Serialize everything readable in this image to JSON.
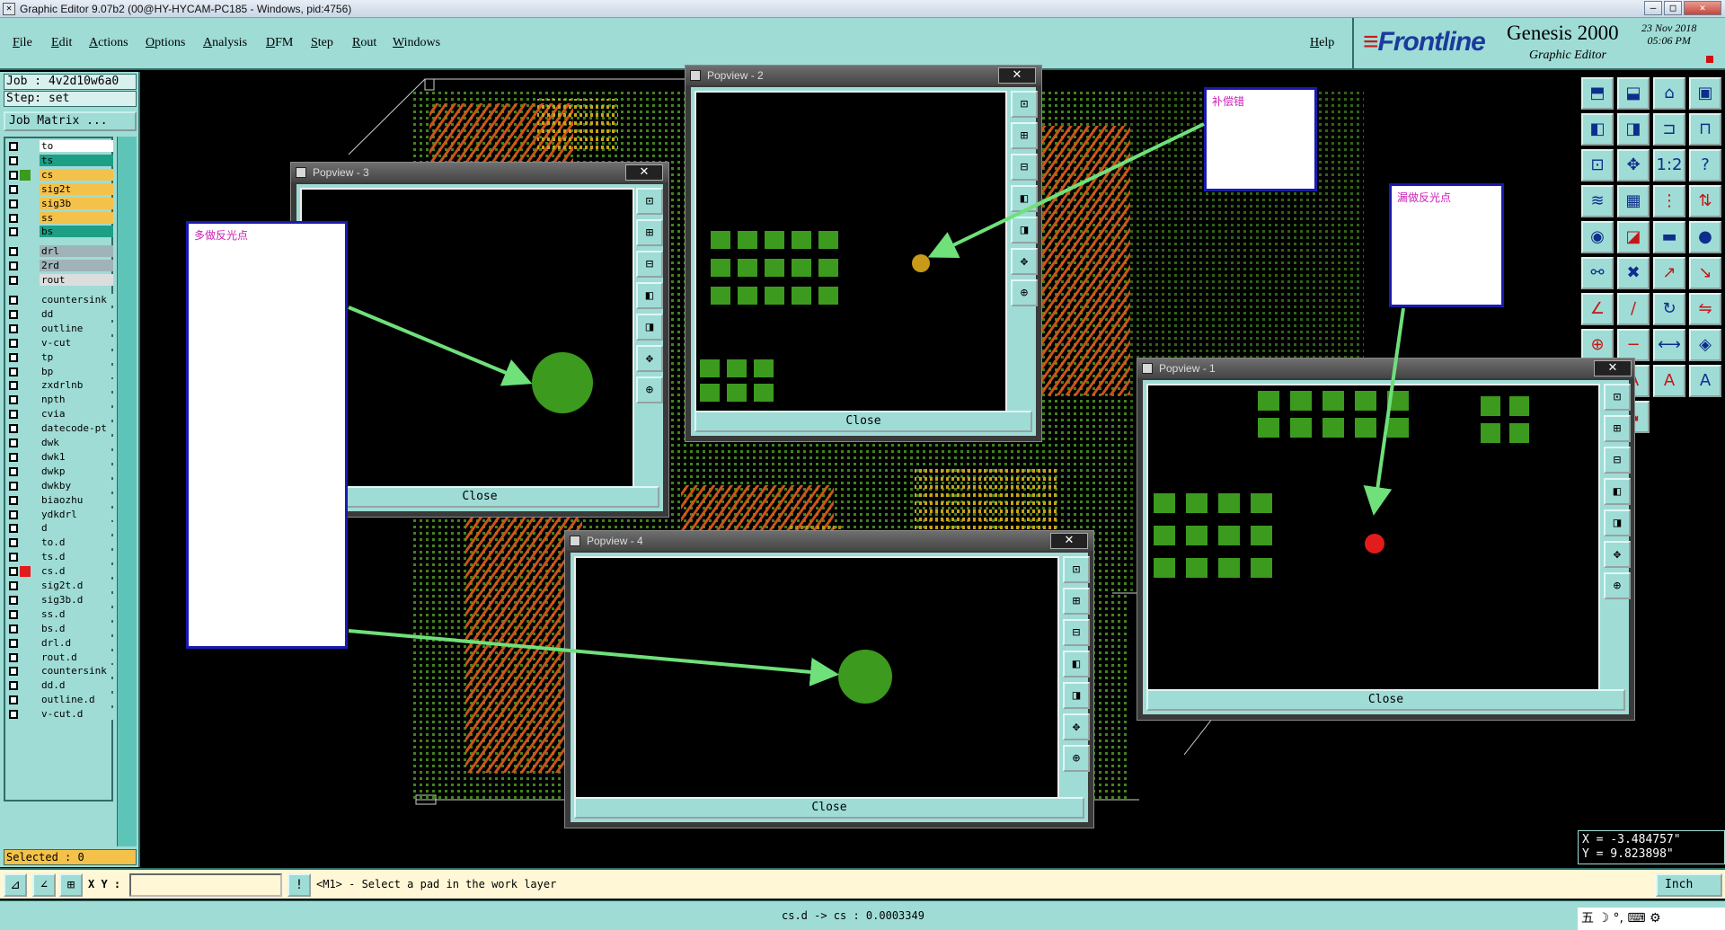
{
  "window": {
    "title": "Graphic Editor 9.07b2 (00@HY-HYCAM-PC185 - Windows, pid:4756)",
    "min_label": "–",
    "max_label": "□",
    "close_label": "✕"
  },
  "menu": [
    "File",
    "Edit",
    "Actions",
    "Options",
    "Analysis",
    "DFM",
    "Step",
    "Rout",
    "Windows"
  ],
  "help_label": "Help",
  "brand": {
    "logo": "Frontline",
    "product": "Genesis 2000",
    "subtitle": "Graphic Editor",
    "date_line1": "23 Nov 2018",
    "time_line2": "05:06 PM"
  },
  "job": {
    "job_label": "Job  : 4v2d10w6a0",
    "step_label": "Step: set",
    "matrix_button": "Job Matrix ..."
  },
  "layers": [
    {
      "name": "to",
      "bg": "#ffffff",
      "sw": ""
    },
    {
      "name": "ts",
      "bg": "#1d9f86",
      "sw": ""
    },
    {
      "name": "cs",
      "bg": "#f4c24a",
      "sw": "#3c9a1e"
    },
    {
      "name": "sig2t",
      "bg": "#f4c24a",
      "sw": ""
    },
    {
      "name": "sig3b",
      "bg": "#f4c24a",
      "sw": ""
    },
    {
      "name": "ss",
      "bg": "#f4c24a",
      "sw": ""
    },
    {
      "name": "bs",
      "bg": "#1d9f86",
      "sw": ""
    },
    {
      "name": "drl",
      "bg": "#9fb3b8",
      "sw": ""
    },
    {
      "name": "2rd",
      "bg": "#9fb3b8",
      "sw": ""
    },
    {
      "name": "rout",
      "bg": "#dddddd",
      "sw": ""
    },
    {
      "name": "countersink",
      "bg": "#9fdcd6",
      "sw": ""
    },
    {
      "name": "dd",
      "bg": "#9fdcd6",
      "sw": ""
    },
    {
      "name": "outline",
      "bg": "#9fdcd6",
      "sw": ""
    },
    {
      "name": "v-cut",
      "bg": "#9fdcd6",
      "sw": ""
    },
    {
      "name": "tp",
      "bg": "#9fdcd6",
      "sw": ""
    },
    {
      "name": "bp",
      "bg": "#9fdcd6",
      "sw": ""
    },
    {
      "name": "zxdrlnb",
      "bg": "#9fdcd6",
      "sw": ""
    },
    {
      "name": "npth",
      "bg": "#9fdcd6",
      "sw": ""
    },
    {
      "name": "cvia",
      "bg": "#9fdcd6",
      "sw": ""
    },
    {
      "name": "datecode-pt",
      "bg": "#9fdcd6",
      "sw": ""
    },
    {
      "name": "dwk",
      "bg": "#9fdcd6",
      "sw": ""
    },
    {
      "name": "dwk1",
      "bg": "#9fdcd6",
      "sw": ""
    },
    {
      "name": "dwkp",
      "bg": "#9fdcd6",
      "sw": ""
    },
    {
      "name": "dwkby",
      "bg": "#9fdcd6",
      "sw": ""
    },
    {
      "name": "biaozhu",
      "bg": "#9fdcd6",
      "sw": ""
    },
    {
      "name": "ydkdrl",
      "bg": "#9fdcd6",
      "sw": ""
    },
    {
      "name": "d",
      "bg": "#9fdcd6",
      "sw": ""
    },
    {
      "name": "to.d",
      "bg": "#9fdcd6",
      "sw": ""
    },
    {
      "name": "ts.d",
      "bg": "#9fdcd6",
      "sw": ""
    },
    {
      "name": "cs.d",
      "bg": "#9fdcd6",
      "sw": "#e21c1c"
    },
    {
      "name": "sig2t.d",
      "bg": "#9fdcd6",
      "sw": ""
    },
    {
      "name": "sig3b.d",
      "bg": "#9fdcd6",
      "sw": ""
    },
    {
      "name": "ss.d",
      "bg": "#9fdcd6",
      "sw": ""
    },
    {
      "name": "bs.d",
      "bg": "#9fdcd6",
      "sw": ""
    },
    {
      "name": "drl.d",
      "bg": "#9fdcd6",
      "sw": ""
    },
    {
      "name": "rout.d",
      "bg": "#9fdcd6",
      "sw": ""
    },
    {
      "name": "countersink",
      "bg": "#9fdcd6",
      "sw": ""
    },
    {
      "name": "dd.d",
      "bg": "#9fdcd6",
      "sw": ""
    },
    {
      "name": "outline.d",
      "bg": "#9fdcd6",
      "sw": ""
    },
    {
      "name": "v-cut.d",
      "bg": "#9fdcd6",
      "sw": ""
    }
  ],
  "selected_label": "Selected : 0",
  "coords": {
    "x": "X = -3.484757\"",
    "y": "Y = 9.823898\""
  },
  "command": {
    "xy_label": "X Y :",
    "xy_value": "",
    "message": "<M1> - Select a pad in the work layer",
    "unit": "Inch"
  },
  "status": {
    "text": "cs.d -> cs : 0.0003349"
  },
  "tray": {
    "text": "五 ☽ °, ⌨ ⚙"
  },
  "popviews": {
    "p1": {
      "title": "Popview - 1",
      "close_x": "✕",
      "close": "Close"
    },
    "p2": {
      "title": "Popview - 2",
      "close_x": "✕",
      "close": "Close"
    },
    "p3": {
      "title": "Popview - 3",
      "close_x": "✕",
      "close": "Close"
    },
    "p4": {
      "title": "Popview - 4",
      "close_x": "✕",
      "close": "Close"
    }
  },
  "notes": {
    "n1": "多做反光点",
    "n2": "补偿错",
    "n3": "漏做反光点"
  },
  "colors": {
    "panel": "#9fdcd6",
    "pad_green": "#3c9a1e",
    "fiducial_orange": "#c89a17",
    "fiducial_red": "#e21c1c",
    "arrow": "#6fe07a",
    "trace_orange": "#e25a1b"
  }
}
